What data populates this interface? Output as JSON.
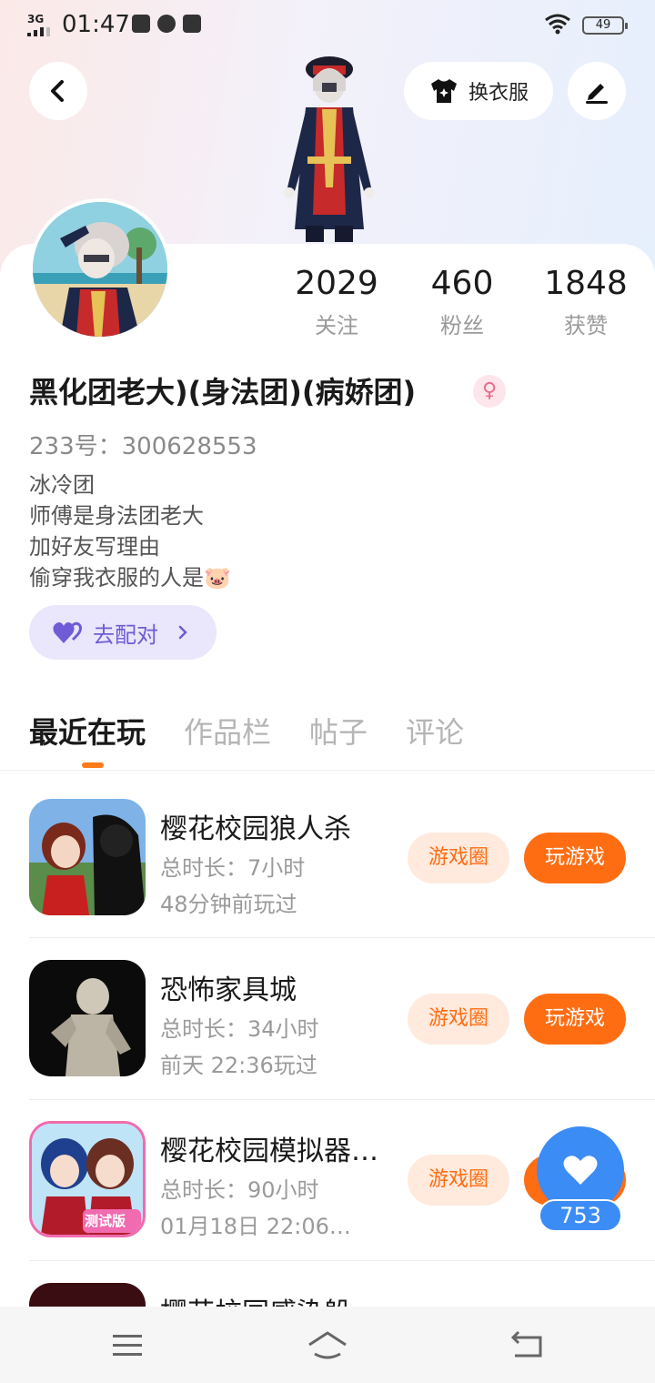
{
  "status_bar": {
    "network": "3G",
    "time": "01:47",
    "battery": "49"
  },
  "header": {
    "outfit_label": "换衣服"
  },
  "profile": {
    "stats": [
      {
        "value": "2029",
        "label": "关注"
      },
      {
        "value": "460",
        "label": "粉丝"
      },
      {
        "value": "1848",
        "label": "获赞"
      }
    ],
    "nickname": "黑化团老大)(身法团)(病娇团)",
    "gender_symbol": "♀",
    "user_id": "233号：300628553",
    "bio": [
      "冰冷团",
      "师傅是身法团老大",
      "加好友写理由",
      "偷穿我衣服的人是🐷"
    ],
    "match_label": "去配对"
  },
  "tabs": [
    "最近在玩",
    "作品栏",
    "帖子",
    "评论"
  ],
  "games": [
    {
      "name": "樱花校园狼人杀",
      "duration": "总时长：7小时",
      "last_played": "48分钟前玩过",
      "circle_label": "游戏圈",
      "play_label": "玩游戏"
    },
    {
      "name": "恐怖家具城",
      "duration": "总时长：34小时",
      "last_played": "前天 22:36玩过",
      "circle_label": "游戏圈",
      "play_label": "玩游戏"
    },
    {
      "name": "樱花校园模拟器…",
      "duration": "总时长：90小时",
      "last_played": "01月18日 22:06…",
      "circle_label": "游戏圈",
      "play_label": "玩游戏",
      "icon_badge": "测试版"
    },
    {
      "name": "樱花校园感染躲…"
    }
  ],
  "like_float": {
    "count": "753"
  },
  "colors": {
    "accent": "#ff6d13",
    "match": "#6f5cd6",
    "like": "#3b8cf5"
  }
}
